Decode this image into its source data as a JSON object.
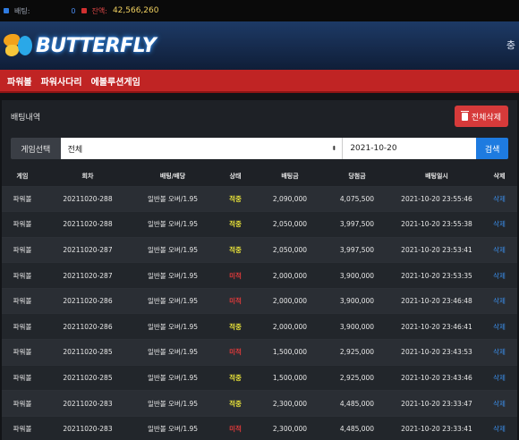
{
  "topbar": {
    "bet_label": "배팅:",
    "bet_count": "0",
    "balance_label": "잔액:",
    "balance": "42,566,260"
  },
  "header": {
    "logo_text": "BUTTERFLY",
    "right_char": "충"
  },
  "nav": {
    "items": [
      "파워볼",
      "파워사다리",
      "에볼루션게임"
    ]
  },
  "panel": {
    "title": "배팅내역",
    "delete_all_label": "전체삭제"
  },
  "filter": {
    "label": "게임선택",
    "selected": "전체",
    "date": "2021-10-20",
    "search_label": "검색"
  },
  "table": {
    "headers": [
      "게임",
      "회차",
      "배팅/배당",
      "상태",
      "배팅금",
      "당첨금",
      "배팅일시",
      "삭제"
    ],
    "rows": [
      {
        "game": "파워볼",
        "round": "20211020-288",
        "bet": "일반볼 오버/1.95",
        "status": "적중",
        "status_type": "hit",
        "amount": "2,090,000",
        "win": "4,075,500",
        "time": "2021-10-20 23:55:46",
        "del": "삭제"
      },
      {
        "game": "파워볼",
        "round": "20211020-288",
        "bet": "일반볼 오버/1.95",
        "status": "적중",
        "status_type": "hit",
        "amount": "2,050,000",
        "win": "3,997,500",
        "time": "2021-10-20 23:55:38",
        "del": "삭제"
      },
      {
        "game": "파워볼",
        "round": "20211020-287",
        "bet": "일반볼 오버/1.95",
        "status": "적중",
        "status_type": "hit",
        "amount": "2,050,000",
        "win": "3,997,500",
        "time": "2021-10-20 23:53:41",
        "del": "삭제"
      },
      {
        "game": "파워볼",
        "round": "20211020-287",
        "bet": "일반볼 오버/1.95",
        "status": "미적",
        "status_type": "miss",
        "amount": "2,000,000",
        "win": "3,900,000",
        "time": "2021-10-20 23:53:35",
        "del": "삭제"
      },
      {
        "game": "파워볼",
        "round": "20211020-286",
        "bet": "일반볼 오버/1.95",
        "status": "미적",
        "status_type": "miss",
        "amount": "2,000,000",
        "win": "3,900,000",
        "time": "2021-10-20 23:46:48",
        "del": "삭제"
      },
      {
        "game": "파워볼",
        "round": "20211020-286",
        "bet": "일반볼 오버/1.95",
        "status": "적중",
        "status_type": "hit",
        "amount": "2,000,000",
        "win": "3,900,000",
        "time": "2021-10-20 23:46:41",
        "del": "삭제"
      },
      {
        "game": "파워볼",
        "round": "20211020-285",
        "bet": "일반볼 오버/1.95",
        "status": "미적",
        "status_type": "miss",
        "amount": "1,500,000",
        "win": "2,925,000",
        "time": "2021-10-20 23:43:53",
        "del": "삭제"
      },
      {
        "game": "파워볼",
        "round": "20211020-285",
        "bet": "일반볼 오버/1.95",
        "status": "적중",
        "status_type": "hit",
        "amount": "1,500,000",
        "win": "2,925,000",
        "time": "2021-10-20 23:43:46",
        "del": "삭제"
      },
      {
        "game": "파워볼",
        "round": "20211020-283",
        "bet": "일반볼 오버/1.95",
        "status": "적중",
        "status_type": "hit",
        "amount": "2,300,000",
        "win": "4,485,000",
        "time": "2021-10-20 23:33:47",
        "del": "삭제"
      },
      {
        "game": "파워볼",
        "round": "20211020-283",
        "bet": "일반볼 오버/1.95",
        "status": "미적",
        "status_type": "miss",
        "amount": "2,300,000",
        "win": "4,485,000",
        "time": "2021-10-20 23:33:41",
        "del": "삭제"
      }
    ]
  },
  "colors": {
    "nav_red": "#c02424",
    "hit_yellow": "#e8e23a",
    "miss_red": "#e03a3a",
    "search_blue": "#1e7be0"
  }
}
